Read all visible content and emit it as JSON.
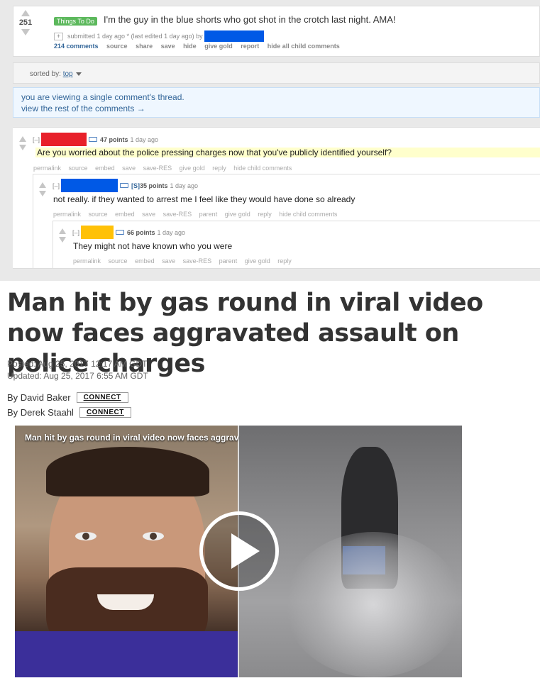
{
  "post": {
    "score": "251",
    "flair": "Things To Do",
    "title": "I'm the guy in the blue shorts who got shot in the crotch last night. AMA!",
    "expando": "+",
    "meta": "submitted 1 day ago * (last edited 1 day ago) by",
    "buttons": [
      "214 comments",
      "source",
      "share",
      "save",
      "hide",
      "give gold",
      "report",
      "hide all child comments"
    ]
  },
  "sort": {
    "label": "sorted by:",
    "value": "top"
  },
  "thread_notice": {
    "line1": "you are viewing a single comment's thread.",
    "line2": "view the rest of the comments →"
  },
  "comments": [
    {
      "collapse": "[–]",
      "points": "47 points",
      "time": "1 day ago",
      "text": "Are you worried about the police pressing charges now that you've publicly identified yourself?",
      "redaction_color": "#e8202a",
      "buttons": [
        "permalink",
        "source",
        "embed",
        "save",
        "save-RES",
        "give gold",
        "reply",
        "hide child comments"
      ]
    },
    {
      "collapse": "[–]",
      "submitter_tag": "[S]",
      "points": "35 points",
      "time": "1 day ago",
      "text": "not really. if they wanted to arrest me I feel like they would have done so already",
      "redaction_color": "#0059e6",
      "buttons": [
        "permalink",
        "source",
        "embed",
        "save",
        "save-RES",
        "parent",
        "give gold",
        "reply",
        "hide child comments"
      ]
    },
    {
      "collapse": "[–]",
      "points": "66 points",
      "time": "1 day ago",
      "text": "They might not have known who you were",
      "redaction_color": "#ffc107",
      "buttons": [
        "permalink",
        "source",
        "embed",
        "save",
        "save-RES",
        "parent",
        "give gold",
        "reply"
      ]
    }
  ],
  "article": {
    "headline": "Man hit by gas round in viral video now faces aggravated assault on police charges",
    "posted": "Posted: Aug 25, 2017 12:17 AM GDT",
    "updated": "Updated: Aug 25, 2017 6:55 AM GDT",
    "authors": [
      {
        "name": "By David Baker",
        "connect": "CONNECT"
      },
      {
        "name": "By Derek Staahl",
        "connect": "CONNECT"
      }
    ],
    "video_title": "Man hit by gas round in viral video now faces aggrav"
  }
}
